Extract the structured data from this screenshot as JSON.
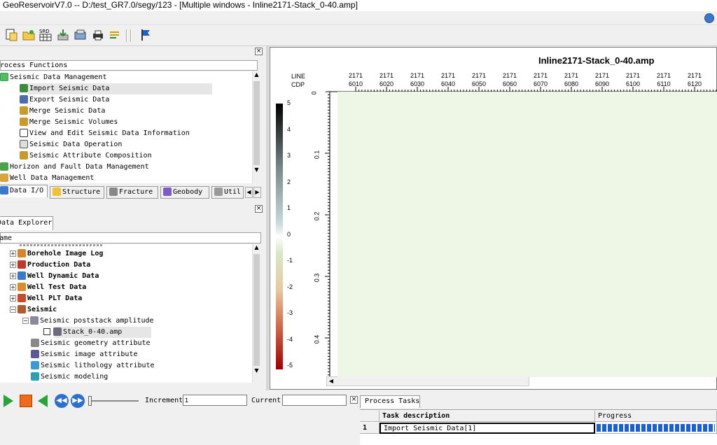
{
  "window": {
    "title": "GeoReservoirV7.0 -- D:/test_GR7.0/segy/123 - [Multiple windows - Inline2171-Stack_0-40.amp]"
  },
  "toolbar": {
    "srd_label": "SRD",
    "icons": [
      "new-doc-icon",
      "open-folder-icon",
      "srd-grid-icon",
      "install-icon",
      "export-icon",
      "print-icon",
      "list-icon",
      "flag-icon"
    ]
  },
  "process_functions": {
    "header": "Process Functions",
    "items": [
      {
        "label": "Seismic Data Management",
        "icon": "seismic-mgmt-icon"
      },
      {
        "label": "Import Seismic Data",
        "icon": "import-icon"
      },
      {
        "label": "Export Seismic Data",
        "icon": "export-icon"
      },
      {
        "label": "Merge Seismic Data",
        "icon": "merge-icon"
      },
      {
        "label": "Merge Seismic Volumes",
        "icon": "merge-icon"
      },
      {
        "label": "View and Edit Seismic Data Information",
        "icon": "view-edit-icon"
      },
      {
        "label": "Seismic Data Operation",
        "icon": "calculator-icon"
      },
      {
        "label": "Seismic Attribute Composition",
        "icon": "attribute-icon"
      },
      {
        "label": "Horizon and Fault Data Management",
        "icon": "horizon-icon"
      },
      {
        "label": "Well Data Management",
        "icon": "well-icon"
      }
    ],
    "tabs": [
      "Data I/O",
      "Structure",
      "Fracture",
      "Geobody",
      "Util"
    ]
  },
  "data_explorer": {
    "tab": "Data Explorer",
    "column": "Name",
    "items": [
      {
        "label": "Borehole Image Log",
        "bold": true
      },
      {
        "label": "Production Data",
        "bold": true
      },
      {
        "label": "Well Dynamic Data",
        "bold": true
      },
      {
        "label": "Well Test Data",
        "bold": true
      },
      {
        "label": "Well PLT Data",
        "bold": true
      },
      {
        "label": "Seismic",
        "bold": true
      },
      {
        "label": "Seismic poststack amplitude",
        "bold": false
      },
      {
        "label": "Stack_0-40.amp",
        "bold": false
      },
      {
        "label": "Seismic geometry attribute",
        "bold": false
      },
      {
        "label": "Seismic image attribute",
        "bold": false
      },
      {
        "label": "Seismic lithology attribute",
        "bold": false
      },
      {
        "label": "Seismic modeling",
        "bold": false
      }
    ]
  },
  "seismic_view": {
    "title": "Inline2171-Stack_0-40.amp",
    "row_labels": [
      "LINE",
      "CDP"
    ],
    "line_value": "2171",
    "cdp_values": [
      "6010",
      "6020",
      "6030",
      "6040",
      "6050",
      "6060",
      "6070",
      "6080",
      "6090",
      "6100",
      "6110",
      "6120"
    ],
    "time_ticks": [
      "0",
      "0.1",
      "0.2",
      "0.3",
      "0.4"
    ],
    "colorbar_ticks": [
      "5",
      "4",
      "3",
      "2",
      "1",
      "0",
      "-1",
      "-2",
      "-3",
      "-4",
      "-5"
    ]
  },
  "playback": {
    "increment_label": "Increment",
    "increment_value": "1",
    "current_label": "Current",
    "current_value": ""
  },
  "process_tasks": {
    "tab": "Process Tasks",
    "columns": [
      "Task description",
      "Progress"
    ],
    "rows": [
      {
        "index": "1",
        "description": "Import Seismic Data[1]",
        "progress": 1.0
      }
    ]
  },
  "colors": {
    "progress": "#1a5fd6",
    "plot_bg": "#eef6e6",
    "selection": "#e6e6e6"
  }
}
